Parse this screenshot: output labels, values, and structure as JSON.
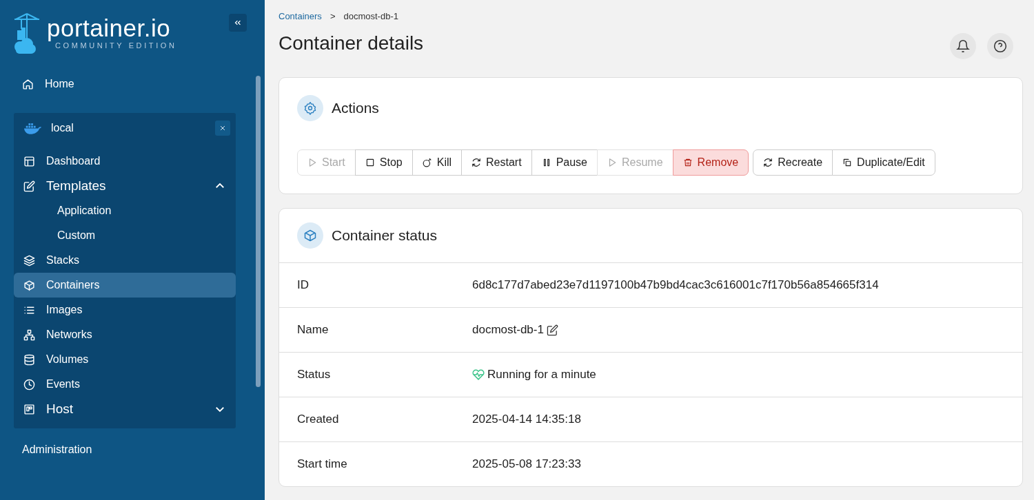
{
  "logo": {
    "title": "portainer.io",
    "subtitle": "COMMUNITY EDITION"
  },
  "sidebar": {
    "home": {
      "label": "Home",
      "kind": "home",
      "selected": false
    },
    "environment": {
      "name": "local",
      "items": [
        {
          "label": "Dashboard",
          "kind": "dashboard",
          "selected": false
        },
        {
          "label": "Templates",
          "kind": "templates",
          "selected": false,
          "expanded": true,
          "children": [
            {
              "label": "Application",
              "selected": false
            },
            {
              "label": "Custom",
              "selected": false
            }
          ]
        },
        {
          "label": "Stacks",
          "kind": "stacks",
          "selected": false
        },
        {
          "label": "Containers",
          "kind": "containers",
          "selected": true
        },
        {
          "label": "Images",
          "kind": "images",
          "selected": false
        },
        {
          "label": "Networks",
          "kind": "networks",
          "selected": false
        },
        {
          "label": "Volumes",
          "kind": "volumes",
          "selected": false
        },
        {
          "label": "Events",
          "kind": "events",
          "selected": false
        },
        {
          "label": "Host",
          "kind": "host",
          "selected": false,
          "expanded": false
        }
      ]
    },
    "footer": "Administration"
  },
  "breadcrumb": [
    "Containers",
    "docmost-db-1"
  ],
  "breadcrumb_separator": ">",
  "page_title": "Container details",
  "actions": {
    "title": "Actions",
    "groups": [
      [
        {
          "label": "Start",
          "kind": "start",
          "disabled": true,
          "danger": false
        },
        {
          "label": "Stop",
          "kind": "stop",
          "disabled": false,
          "danger": false
        },
        {
          "label": "Kill",
          "kind": "kill",
          "disabled": false,
          "danger": false
        },
        {
          "label": "Restart",
          "kind": "restart",
          "disabled": false,
          "danger": false
        },
        {
          "label": "Pause",
          "kind": "pause",
          "disabled": false,
          "danger": false
        },
        {
          "label": "Resume",
          "kind": "resume",
          "disabled": true,
          "danger": false
        },
        {
          "label": "Remove",
          "kind": "remove",
          "disabled": false,
          "danger": true
        }
      ],
      [
        {
          "label": "Recreate",
          "kind": "recreate",
          "disabled": false,
          "danger": false
        },
        {
          "label": "Duplicate/Edit",
          "kind": "duplicate",
          "disabled": false,
          "danger": false
        }
      ]
    ]
  },
  "status": {
    "title": "Container status",
    "rows": [
      {
        "label": "ID",
        "value": "6d8c177d7abed23e7d1197100b47b9bd4cac3c616001c7f170b56a854665f314",
        "kind": "text"
      },
      {
        "label": "Name",
        "value": "docmost-db-1",
        "kind": "name"
      },
      {
        "label": "Status",
        "value": "Running for a minute",
        "kind": "status"
      },
      {
        "label": "Created",
        "value": "2025-04-14 14:35:18",
        "kind": "text"
      },
      {
        "label": "Start time",
        "value": "2025-05-08 17:23:33",
        "kind": "text"
      }
    ]
  }
}
